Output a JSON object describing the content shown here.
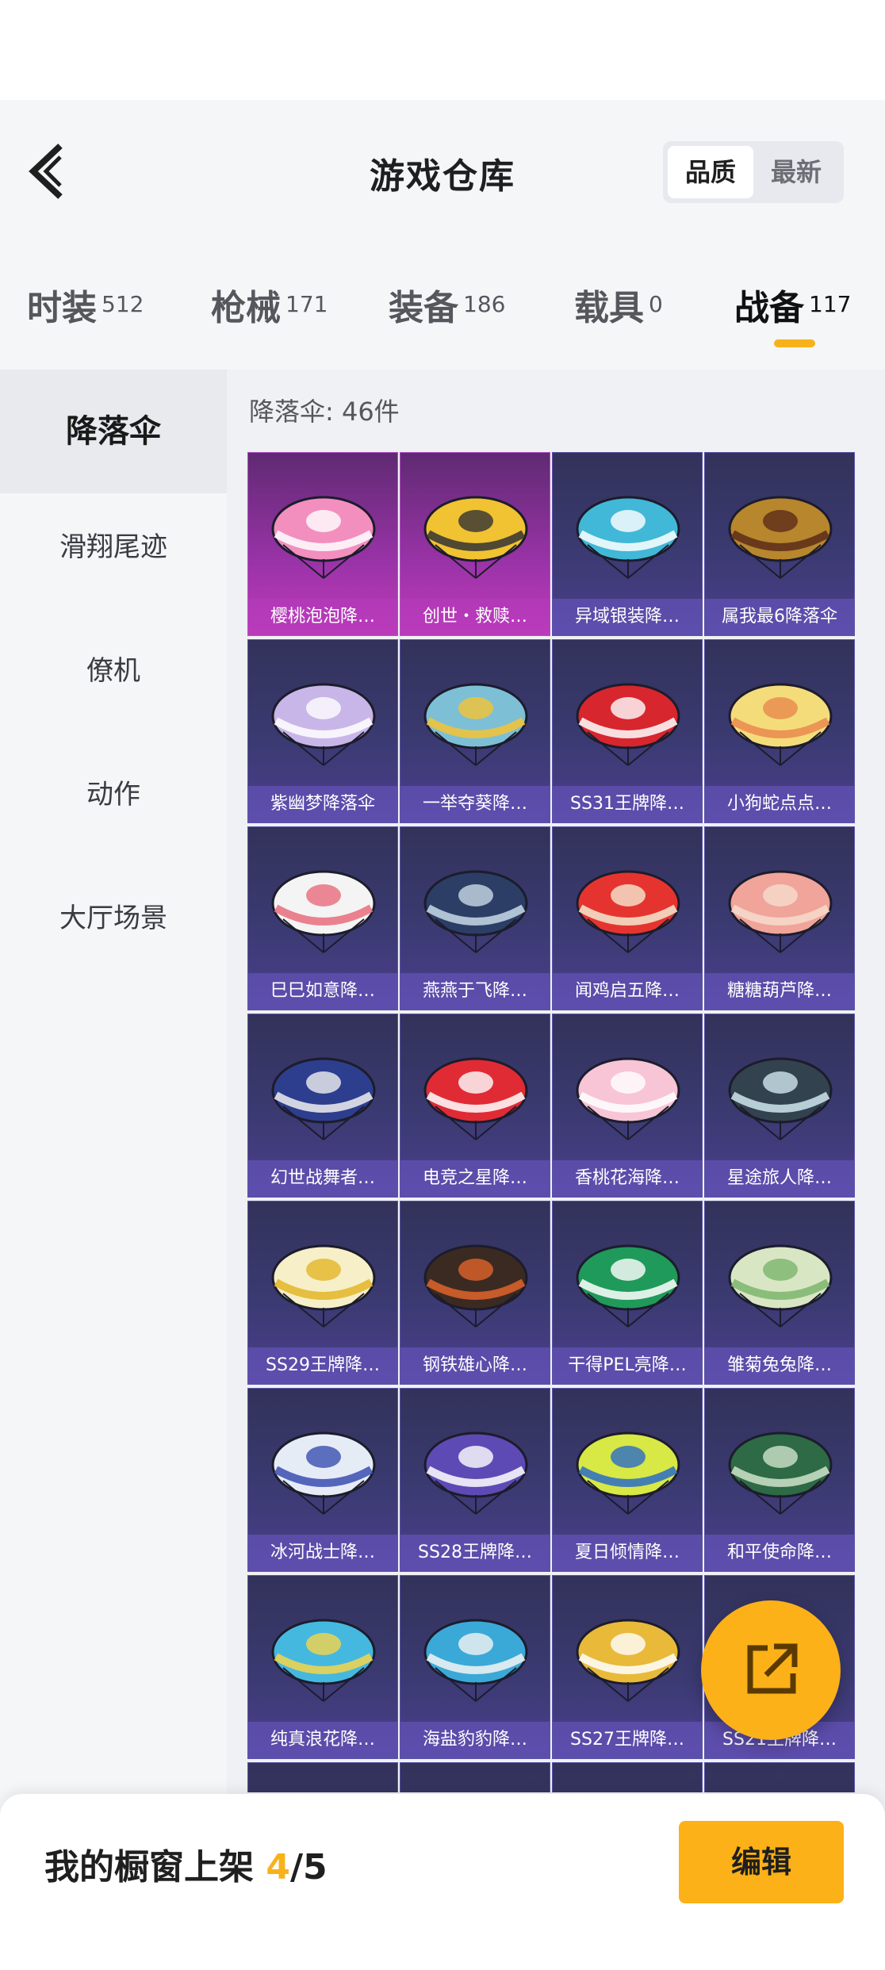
{
  "header": {
    "title": "游戏仓库",
    "sort_options": [
      "品质",
      "最新"
    ]
  },
  "tabs": [
    {
      "label": "时装",
      "count": "512"
    },
    {
      "label": "枪械",
      "count": "171"
    },
    {
      "label": "装备",
      "count": "186"
    },
    {
      "label": "载具",
      "count": "0"
    },
    {
      "label": "战备",
      "count": "117"
    }
  ],
  "sidebar": {
    "items": [
      "降落伞",
      "滑翔尾迹",
      "僚机",
      "动作",
      "大厅场景"
    ]
  },
  "main": {
    "count_label": "降落伞: 46件",
    "items": [
      {
        "name": "樱桃泡泡降…",
        "colors": [
          "#f28fbf",
          "#ffffff"
        ]
      },
      {
        "name": "创世・救赎…",
        "colors": [
          "#f1c232",
          "#333333"
        ]
      },
      {
        "name": "异域银装降…",
        "colors": [
          "#41b8d8",
          "#ffffff"
        ]
      },
      {
        "name": "属我最6降落伞",
        "colors": [
          "#b8862c",
          "#5b2c1a"
        ]
      },
      {
        "name": "紫幽梦降落伞",
        "colors": [
          "#c9b6e8",
          "#ffffff"
        ]
      },
      {
        "name": "一举夺葵降…",
        "colors": [
          "#7dc0d6",
          "#f5c332"
        ]
      },
      {
        "name": "SS31王牌降…",
        "colors": [
          "#d8262e",
          "#ffffff"
        ]
      },
      {
        "name": "小狗蛇点点…",
        "colors": [
          "#f5dc7a",
          "#e98a4d"
        ]
      },
      {
        "name": "巳巳如意降…",
        "colors": [
          "#f4f4f4",
          "#e86c7d"
        ]
      },
      {
        "name": "燕燕于飞降…",
        "colors": [
          "#2c3e66",
          "#c8d9e6"
        ]
      },
      {
        "name": "闻鸡启五降…",
        "colors": [
          "#e5342f",
          "#f5e9d0"
        ]
      },
      {
        "name": "糖糖葫芦降…",
        "colors": [
          "#f0a49a",
          "#f6dccd"
        ]
      },
      {
        "name": "幻世战舞者…",
        "colors": [
          "#2d3e8e",
          "#f0f0f0"
        ]
      },
      {
        "name": "电竞之星降…",
        "colors": [
          "#e02b35",
          "#ffffff"
        ]
      },
      {
        "name": "香桃花海降…",
        "colors": [
          "#f7c5d6",
          "#ffffff"
        ]
      },
      {
        "name": "星途旅人降…",
        "colors": [
          "#33424f",
          "#cfe6ee"
        ]
      },
      {
        "name": "SS29王牌降…",
        "colors": [
          "#f6efc8",
          "#e3b528"
        ]
      },
      {
        "name": "钢铁雄心降…",
        "colors": [
          "#3b2a22",
          "#e0642a"
        ]
      },
      {
        "name": "干得PEL亮降…",
        "colors": [
          "#1f9a5a",
          "#ffffff"
        ]
      },
      {
        "name": "雏菊兔兔降…",
        "colors": [
          "#d9e6c4",
          "#7bb56d"
        ]
      },
      {
        "name": "冰河战士降…",
        "colors": [
          "#e6ecf6",
          "#3a4fb0"
        ]
      },
      {
        "name": "SS28王牌降…",
        "colors": [
          "#5e4ab5",
          "#ffffff"
        ]
      },
      {
        "name": "夏日倾情降…",
        "colors": [
          "#d8e845",
          "#2a6cc7"
        ]
      },
      {
        "name": "和平使命降…",
        "colors": [
          "#2d6a45",
          "#cfe3c9"
        ]
      },
      {
        "name": "纯真浪花降…",
        "colors": [
          "#45b8e0",
          "#f5d54a"
        ]
      },
      {
        "name": "海盐豹豹降…",
        "colors": [
          "#3aa9d8",
          "#f4f4f4"
        ]
      },
      {
        "name": "SS27王牌降…",
        "colors": [
          "#e9b93a",
          "#ffffff"
        ]
      },
      {
        "name": "SS21王牌降…",
        "colors": [
          "#3f3f6a",
          "#c8c8e0"
        ]
      }
    ]
  },
  "bottom_bar": {
    "label": "我的橱窗上架",
    "current": "4",
    "total": "/5",
    "edit_label": "编辑"
  },
  "colors": {
    "accent": "#fbb117",
    "card_epic": "#3b3a72",
    "card_legend": "#9a33a8"
  }
}
